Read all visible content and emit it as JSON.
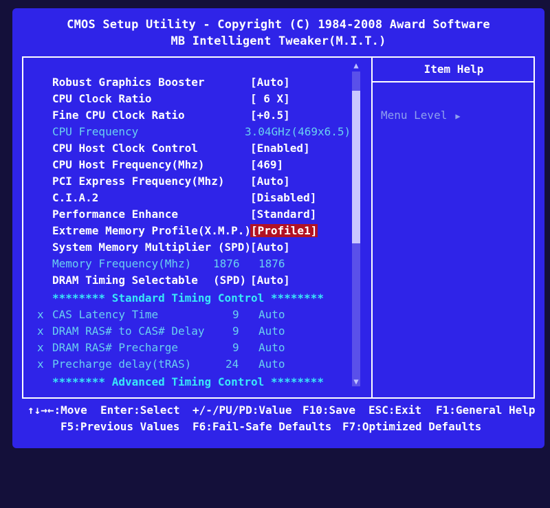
{
  "header": {
    "line1": "CMOS Setup Utility - Copyright (C) 1984-2008 Award Software",
    "line2": "MB Intelligent Tweaker(M.I.T.)"
  },
  "menu": {
    "items": [
      {
        "label": "Robust Graphics Booster",
        "value": "[Auto]"
      },
      {
        "label": "CPU Clock Ratio",
        "value": "[ 6 X]"
      },
      {
        "label": "Fine CPU Clock Ratio",
        "value": "[+0.5]"
      },
      {
        "label": "CPU Frequency",
        "value": "3.04GHz(469x6.5)"
      },
      {
        "label": "CPU Host Clock Control",
        "value": "[Enabled]"
      },
      {
        "label": "CPU Host Frequency(Mhz)",
        "value": "[469]"
      },
      {
        "label": "PCI Express Frequency(Mhz)",
        "value": "[Auto]"
      },
      {
        "label": "C.I.A.2",
        "value": "[Disabled]"
      },
      {
        "label": "Performance Enhance",
        "value": "[Standard]"
      },
      {
        "label": "Extreme Memory Profile(X.M.P.)",
        "value": "[Profile1]"
      },
      {
        "label": "System Memory Multiplier (SPD)",
        "value": "[Auto]"
      },
      {
        "label": "Memory Frequency(Mhz)",
        "spd": "1876",
        "value": "1876"
      },
      {
        "label": "DRAM Timing Selectable",
        "spd": "(SPD)",
        "value": "[Auto]"
      }
    ],
    "standard_timing_header": "******** Standard Timing Control ********",
    "timings": [
      {
        "mark": "x",
        "label": "CAS Latency Time",
        "spd": "9",
        "value": "Auto"
      },
      {
        "mark": "x",
        "label": "DRAM RAS# to CAS# Delay",
        "spd": "9",
        "value": "Auto"
      },
      {
        "mark": "x",
        "label": "DRAM RAS# Precharge",
        "spd": "9",
        "value": "Auto"
      },
      {
        "mark": "x",
        "label": "Precharge delay(tRAS)",
        "spd": "24",
        "value": "Auto"
      }
    ],
    "advanced_timing_header": "******** Advanced Timing Control ********"
  },
  "help": {
    "title": "Item Help",
    "menu_level": "Menu Level"
  },
  "scroll": {
    "up": "▲",
    "down": "▼"
  },
  "footer": {
    "move": "↑↓→←:Move",
    "select": "Enter:Select",
    "value": "+/-/PU/PD:Value",
    "save": "F10:Save",
    "exit": "ESC:Exit",
    "general_help": "F1:General Help",
    "previous": "F5:Previous Values",
    "failsafe": "F6:Fail-Safe Defaults",
    "optimized": "F7:Optimized Defaults"
  },
  "colors": {
    "background": "#2f24e8",
    "text": "#ffffff",
    "dimmed": "#6ad0f0",
    "section": "#39e8f8",
    "highlight": "#b21224"
  }
}
